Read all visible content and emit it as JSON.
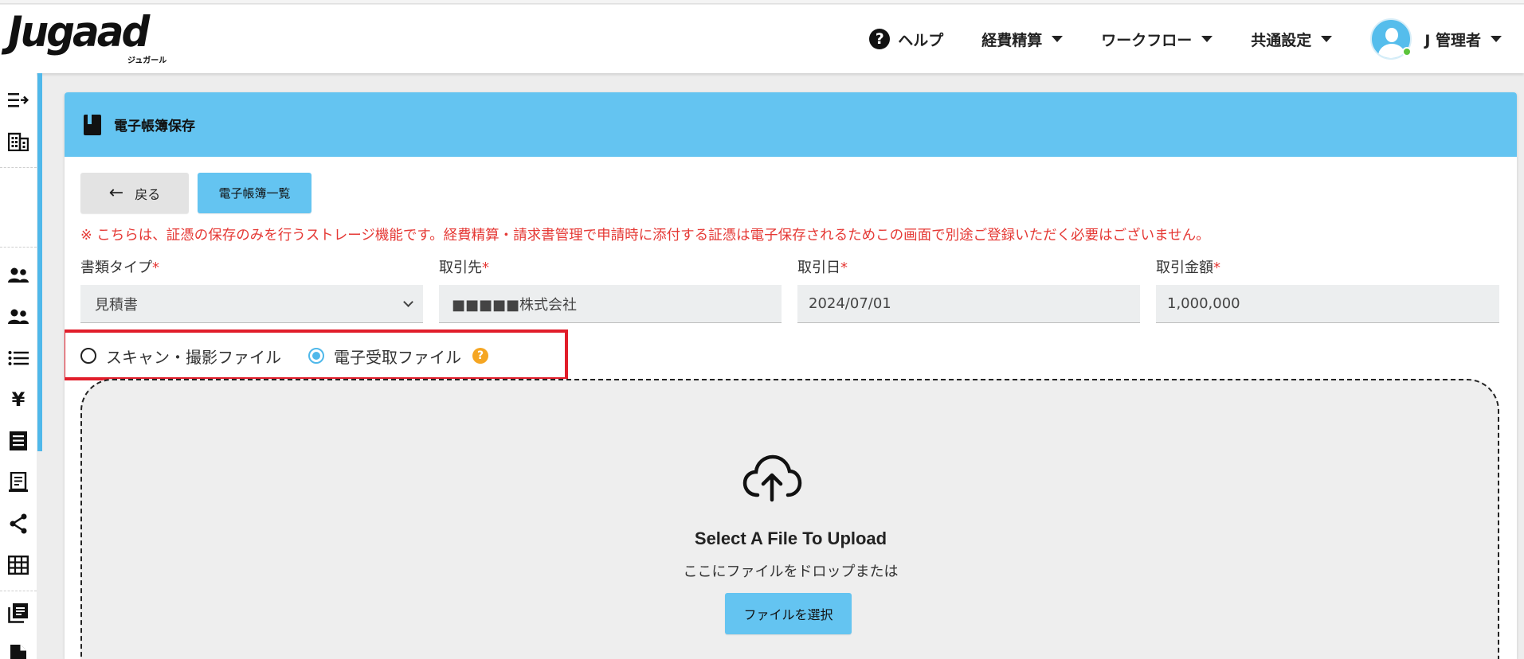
{
  "app": {
    "logo_text": "Jugaad",
    "logo_subtext": "ジュガール"
  },
  "header": {
    "nav": [
      {
        "label": "ヘルプ",
        "icon": "help-circle-icon"
      },
      {
        "label": "経費精算"
      },
      {
        "label": "ワークフロー"
      },
      {
        "label": "共通設定"
      }
    ],
    "user_name": "J 管理者"
  },
  "sidebar": {
    "icons": [
      "menu-collapse-icon",
      "building-icon",
      "users-icon",
      "users-alt-icon",
      "list-icon",
      "yen-icon",
      "receipt-icon",
      "document-icon",
      "share-icon",
      "grid-icon",
      "library-icon",
      "file-icon"
    ]
  },
  "page": {
    "title": "電子帳簿保存",
    "back_label": "戻る",
    "list_label": "電子帳簿一覧",
    "notice": "※ こちらは、証憑の保存のみを行うストレージ機能です。経費精算・請求書管理で申請時に添付する証憑は電子保存されるためこの画面で別途ご登録いただく必要はございません。",
    "fields": {
      "doc_type": {
        "label": "書類タイプ",
        "value": "見積書"
      },
      "partner": {
        "label": "取引先",
        "value": "■■■■■株式会社"
      },
      "date": {
        "label": "取引日",
        "value": "2024/07/01"
      },
      "amount": {
        "label": "取引金額",
        "value": "1,000,000"
      }
    },
    "required_mark": "*",
    "radios": [
      {
        "label": "スキャン・撮影ファイル",
        "checked": false
      },
      {
        "label": "電子受取ファイル",
        "checked": true
      }
    ],
    "help_badge": "?",
    "upload": {
      "title": "Select A File To Upload",
      "subtitle": "ここにファイルをドロップまたは",
      "button": "ファイルを選択"
    }
  },
  "colors": {
    "accent": "#64c4f1",
    "required": "#e53935",
    "highlight": "#e11d2a",
    "badge": "#f5a623"
  }
}
